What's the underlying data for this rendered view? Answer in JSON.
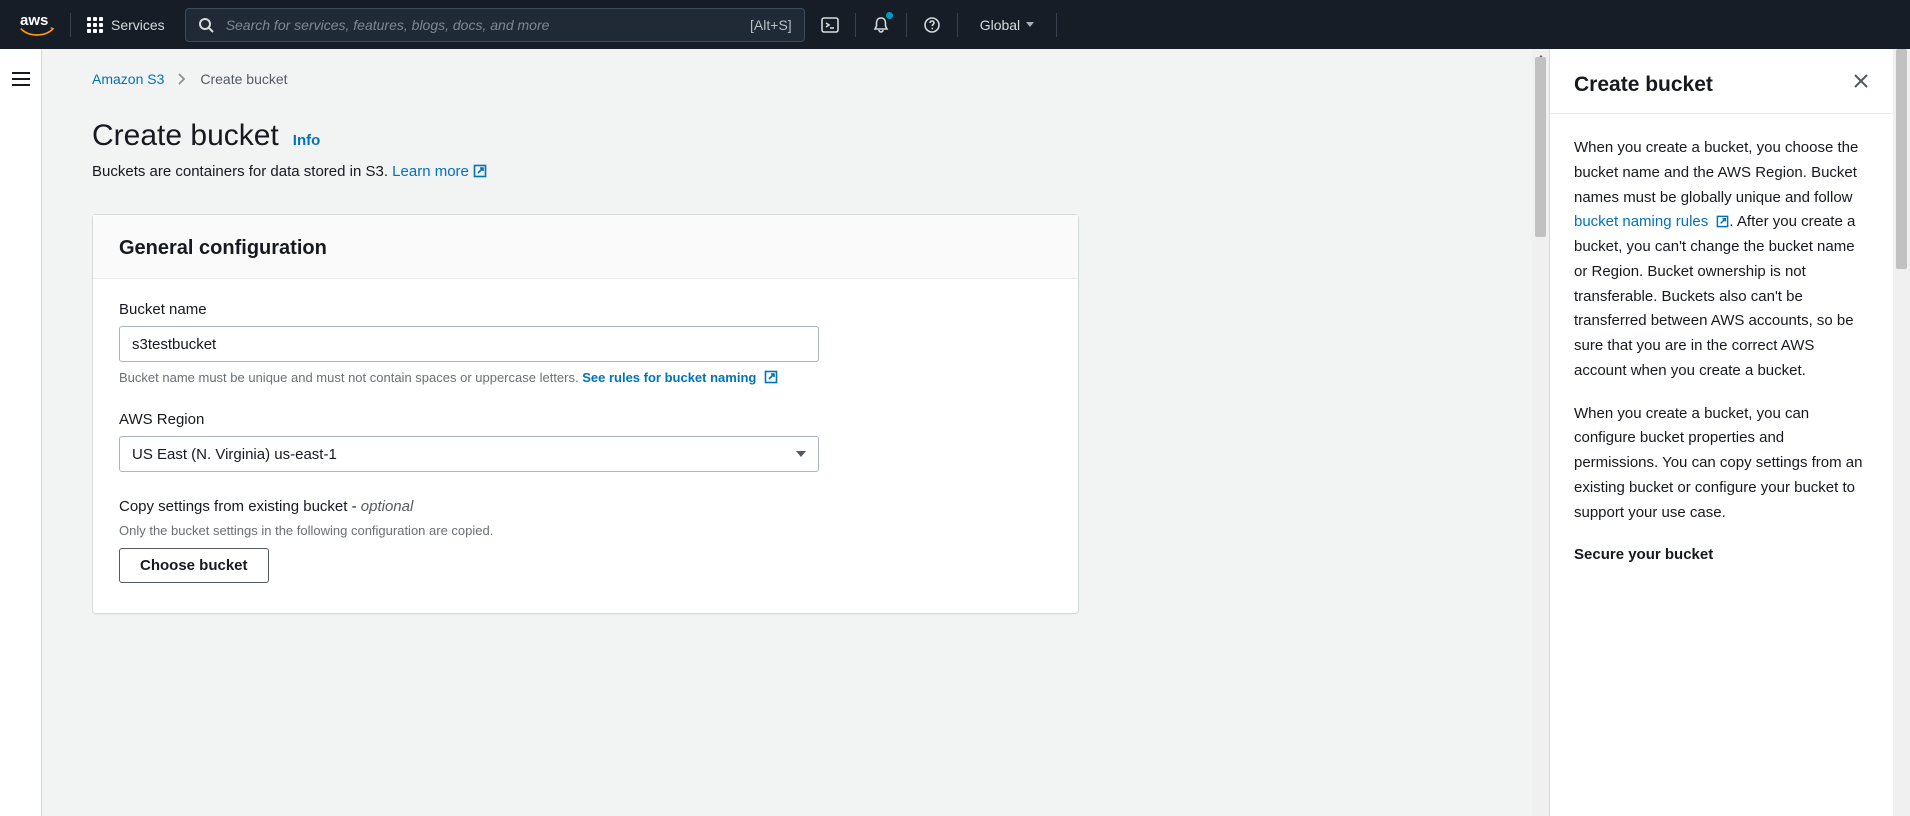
{
  "topnav": {
    "logo_text": "aws",
    "services_label": "Services",
    "search_placeholder": "Search for services, features, blogs, docs, and more",
    "search_shortcut": "[Alt+S]",
    "region_label": "Global"
  },
  "breadcrumb": {
    "root_label": "Amazon S3",
    "current_label": "Create bucket"
  },
  "page": {
    "title": "Create bucket",
    "info_label": "Info",
    "subtitle_pre": "Buckets are containers for data stored in S3. ",
    "subtitle_link": "Learn more"
  },
  "panel": {
    "header": "General configuration",
    "bucket_name_label": "Bucket name",
    "bucket_name_value": "s3testbucket",
    "bucket_name_hint_pre": "Bucket name must be unique and must not contain spaces or uppercase letters. ",
    "bucket_name_hint_link": "See rules for bucket naming",
    "region_label": "AWS Region",
    "region_value": "US East (N. Virginia) us-east-1",
    "copy_label_pre": "Copy settings from existing bucket - ",
    "copy_label_optional": "optional",
    "copy_hint": "Only the bucket settings in the following configuration are copied.",
    "choose_bucket_label": "Choose bucket"
  },
  "help": {
    "title": "Create bucket",
    "p1_pre": "When you create a bucket, you choose the bucket name and the AWS Region. Bucket names must be globally unique and follow ",
    "p1_link": "bucket naming rules",
    "p1_post": ". After you create a bucket, you can't change the bucket name or Region. Bucket ownership is not transferable. Buckets also can't be transferred between AWS accounts, so be sure that you are in the correct AWS account when you create a bucket.",
    "p2": "When you create a bucket, you can configure bucket properties and permissions. You can copy settings from an existing bucket or configure your bucket to support your use case.",
    "sub1": "Secure your bucket"
  }
}
